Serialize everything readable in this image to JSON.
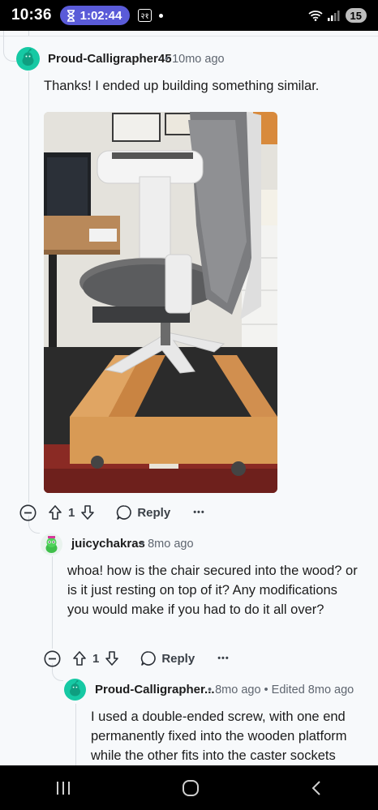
{
  "status_bar": {
    "time": "10:36",
    "timer": "1:02:44",
    "box_text": "२१",
    "battery": "15"
  },
  "comments": [
    {
      "username": "Proud-Calligrapher45",
      "meta": "• 10mo ago",
      "body": "Thanks! I ended up building something similar.",
      "votes": "1",
      "reply_label": "Reply",
      "more_label": "•••"
    },
    {
      "username": "juicychakras",
      "meta": "• 8mo ago",
      "body": "whoa! how is the chair secured into the wood? or is it just resting on top of it? Any modifications you would make if you had to do it all over?",
      "votes": "1",
      "reply_label": "Reply",
      "more_label": "•••"
    },
    {
      "username": "Proud-Calligrapher...",
      "meta": "• 8mo ago • Edited 8mo ago",
      "body": "I used a double-ended screw, with one end permanently fixed into the wooden platform while the other fits into the caster sockets"
    }
  ],
  "colors": {
    "avatar_teal": "#16c9a4",
    "background": "#f7f9fb",
    "thread_line": "#d9dde2"
  }
}
